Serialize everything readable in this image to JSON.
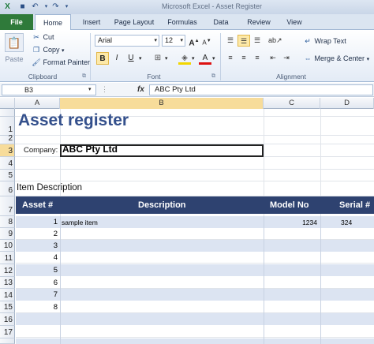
{
  "window": {
    "title": "Microsoft Excel - Asset Register"
  },
  "ribbon_tabs": [
    {
      "label": "File"
    },
    {
      "label": "Home"
    },
    {
      "label": "Insert"
    },
    {
      "label": "Page Layout"
    },
    {
      "label": "Formulas"
    },
    {
      "label": "Data"
    },
    {
      "label": "Review"
    },
    {
      "label": "View"
    }
  ],
  "clipboard": {
    "paste": "Paste",
    "cut": "Cut",
    "copy": "Copy",
    "format_painter": "Format Painter",
    "group": "Clipboard"
  },
  "font": {
    "name": "Arial",
    "size": "12",
    "bold": "B",
    "italic": "I",
    "underline": "U",
    "font_color": "A",
    "group": "Font"
  },
  "alignment": {
    "wrap_text": "Wrap Text",
    "merge": "Merge & Center",
    "group": "Alignment"
  },
  "formula_bar": {
    "name_box": "B3",
    "fx": "fx",
    "value": "ABC Pty Ltd"
  },
  "columns": [
    "A",
    "B",
    "C",
    "D"
  ],
  "rows": [
    "1",
    "2",
    "3",
    "4",
    "5",
    "6",
    "7",
    "8",
    "9",
    "10",
    "11",
    "12",
    "13",
    "14",
    "15",
    "16",
    "17"
  ],
  "sheet": {
    "title": "Asset register",
    "company_label": "Company:",
    "company_value": "ABC Pty Ltd",
    "item_description": "Item Description",
    "table_headers": {
      "asset": "Asset #",
      "description": "Description",
      "model": "Model No",
      "serial": "Serial #"
    },
    "table_rows": [
      {
        "asset": "1",
        "description": "sample item",
        "model": "1234",
        "serial": "324"
      },
      {
        "asset": "2",
        "description": "",
        "model": "",
        "serial": ""
      },
      {
        "asset": "3",
        "description": "",
        "model": "",
        "serial": ""
      },
      {
        "asset": "4",
        "description": "",
        "model": "",
        "serial": ""
      },
      {
        "asset": "5",
        "description": "",
        "model": "",
        "serial": ""
      },
      {
        "asset": "6",
        "description": "",
        "model": "",
        "serial": ""
      },
      {
        "asset": "7",
        "description": "",
        "model": "",
        "serial": ""
      },
      {
        "asset": "8",
        "description": "",
        "model": "",
        "serial": ""
      }
    ]
  },
  "colors": {
    "header_band": "#2e4270",
    "row_band": "#dce4f2",
    "title": "#34508c",
    "file_tab": "#2f7a3a"
  }
}
